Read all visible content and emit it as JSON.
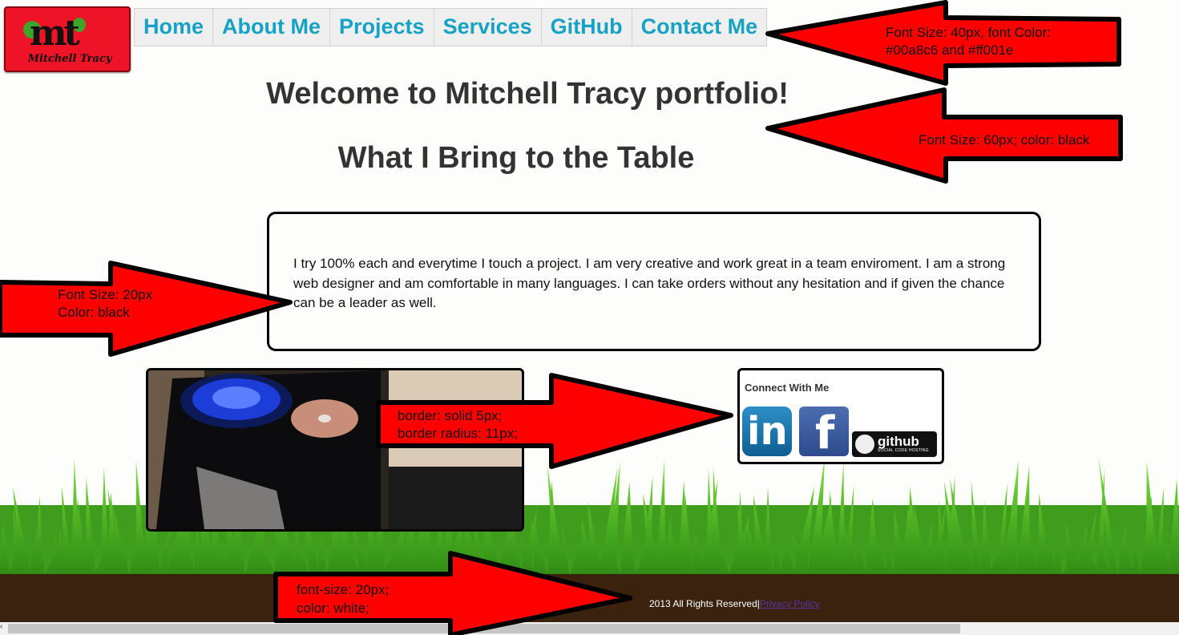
{
  "logo": {
    "text": "Mitchell Tracy",
    "mark": "mt"
  },
  "nav": {
    "items": [
      {
        "label": "Home"
      },
      {
        "label": "About Me"
      },
      {
        "label": "Projects"
      },
      {
        "label": "Services"
      },
      {
        "label": "GitHub"
      },
      {
        "label": "Contact Me"
      }
    ]
  },
  "main": {
    "welcome_heading": "Welcome to Mitchell Tracy portfolio!",
    "table_heading": "What I Bring to the Table",
    "about_text": "I try 100% each and everytime I touch a project. I am very creative and work great in a team enviroment. I am a strong web designer and am comfortable in many languages. I can take orders without any hesitation and if given the chance can be a leader as well."
  },
  "connect": {
    "title": "Connect With Me",
    "linkedin": "in",
    "facebook": "f",
    "github": "github",
    "github_sub": "SOCIAL CODE HOSTING"
  },
  "footer": {
    "text": "2013 All Rights Reserved|",
    "link": "Privacy Policy"
  },
  "annotations": {
    "nav_line1": "Font Size: 40px, font Color:",
    "nav_line2": "#00a8c6 and #ff001e",
    "heading": "Font Size: 60px; color: black",
    "about_line1": "Font Size: 20px",
    "about_line2": "Color: black",
    "border_line1": "border: solid 5px;",
    "border_line2": "border radius: 11px;",
    "footer_line1": "font-size: 20px;",
    "footer_line2": "color: white;"
  },
  "colors": {
    "nav_text": "#16a2c4",
    "arrow_red": "#ff0000",
    "footer_bg": "#3b220f",
    "logo_bg": "#ee1326"
  }
}
